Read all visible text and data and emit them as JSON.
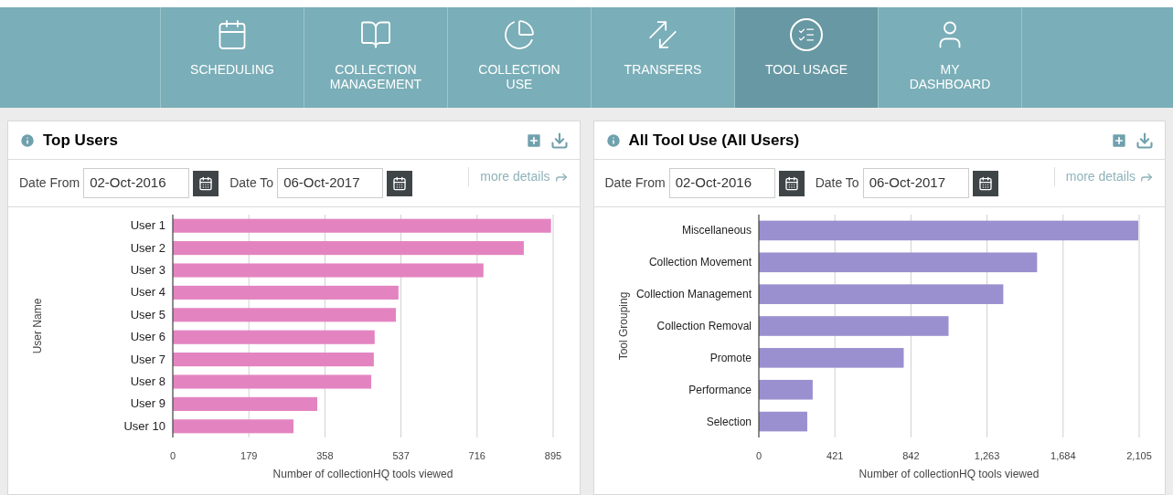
{
  "nav": {
    "items": [
      {
        "label": "SCHEDULING",
        "selected": false
      },
      {
        "label": "COLLECTION MANAGEMENT",
        "selected": false
      },
      {
        "label": "COLLECTION USE",
        "selected": false
      },
      {
        "label": "TRANSFERS",
        "selected": false
      },
      {
        "label": "TOOL USAGE",
        "selected": true
      },
      {
        "label": "MY DASHBOARD",
        "selected": false
      }
    ]
  },
  "panels": [
    {
      "title": "Top Users",
      "date_from_label": "Date From",
      "date_from": "02-Oct-2016",
      "date_to_label": "Date To",
      "date_to": "06-Oct-2017",
      "more_details": "more details",
      "chart_data": {
        "type": "bar",
        "orientation": "horizontal",
        "xlabel": "Number of collectionHQ tools viewed",
        "ylabel": "User Name",
        "categories": [
          "User 1",
          "User 2",
          "User 3",
          "User 4",
          "User 5",
          "User 6",
          "User 7",
          "User 8",
          "User 9",
          "User 10"
        ],
        "series": [
          {
            "color": "#e384c1",
            "values": [
              890,
              826,
              731,
              531,
              525,
              475,
              473,
              467,
              340,
              284
            ]
          }
        ],
        "xlim": [
          0,
          895
        ],
        "xticks": [
          0,
          179,
          358,
          537,
          716,
          895
        ],
        "grid": true
      }
    },
    {
      "title": "All Tool Use (All Users)",
      "date_from_label": "Date From",
      "date_from": "02-Oct-2016",
      "date_to_label": "Date To",
      "date_to": "06-Oct-2017",
      "more_details": "more details",
      "chart_data": {
        "type": "bar",
        "orientation": "horizontal",
        "xlabel": "Number of collectionHQ tools viewed",
        "ylabel": "Tool Grouping",
        "categories": [
          "Miscellaneous",
          "Collection Movement",
          "Collection Management",
          "Collection Removal",
          "Promote",
          "Performance",
          "Selection"
        ],
        "series": [
          {
            "color": "#9a90cf",
            "values": [
              2100,
              1540,
              1353,
              1050,
              802,
              298,
              268
            ]
          }
        ],
        "grid": true,
        "xlim": [
          0,
          2105
        ],
        "xticks": [
          {
            "value": 0,
            "label": "0"
          },
          {
            "value": 421,
            "label": "421"
          },
          {
            "value": 842,
            "label": "842"
          },
          {
            "value": 1263,
            "label": "1,263"
          },
          {
            "value": 1684,
            "label": "1,684"
          },
          {
            "value": 2105,
            "label": "2,105"
          }
        ]
      }
    }
  ]
}
